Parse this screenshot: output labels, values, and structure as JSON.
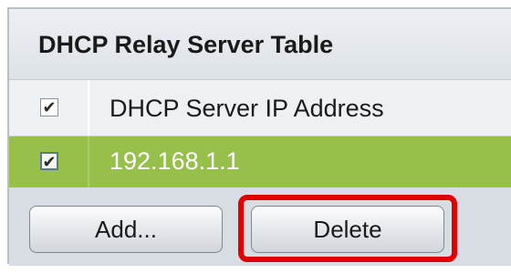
{
  "table": {
    "title": "DHCP Relay Server Table",
    "header": {
      "select_all_checked": true,
      "column_label": "DHCP Server IP Address"
    },
    "rows": [
      {
        "checked": true,
        "ip_address": "192.168.1.1"
      }
    ]
  },
  "buttons": {
    "add_label": "Add...",
    "delete_label": "Delete"
  },
  "colors": {
    "selected_row": "#96c04a",
    "highlight": "#e00000",
    "panel_background": "#d7dde3"
  },
  "icons": {
    "checkbox_checked_glyph": "✔"
  }
}
